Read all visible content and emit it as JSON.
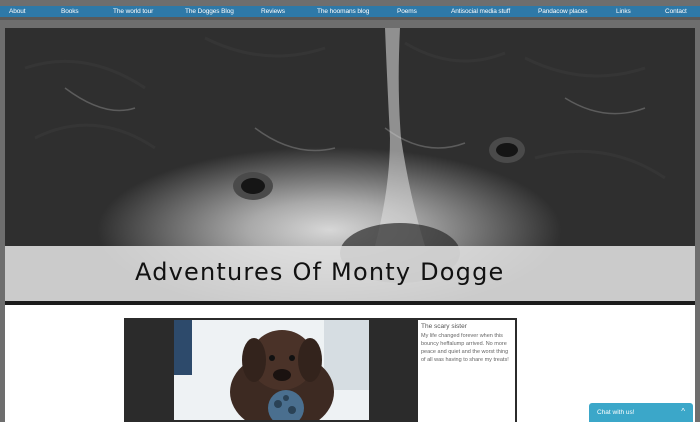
{
  "nav": {
    "items": [
      "About",
      "Books",
      "The world tour",
      "The Dogges Blog",
      "Reviews",
      "The hoomans blog",
      "Poems",
      "Antisocial media stuff",
      "Pandacow places",
      "Links",
      "Contact"
    ]
  },
  "site": {
    "title": "Adventures Of Monty Dogge"
  },
  "post": {
    "title": "The scary sister",
    "excerpt": "My life changed forever when this bouncy heffalump arrived. No more peace and quiet and the worst thing of all was having to share my treats!"
  },
  "chat": {
    "label": "Chat with us!",
    "chevron": "^"
  },
  "colors": {
    "nav": "#2e79a8",
    "chat": "#3ba7c9",
    "background": "#6e6e6e"
  }
}
